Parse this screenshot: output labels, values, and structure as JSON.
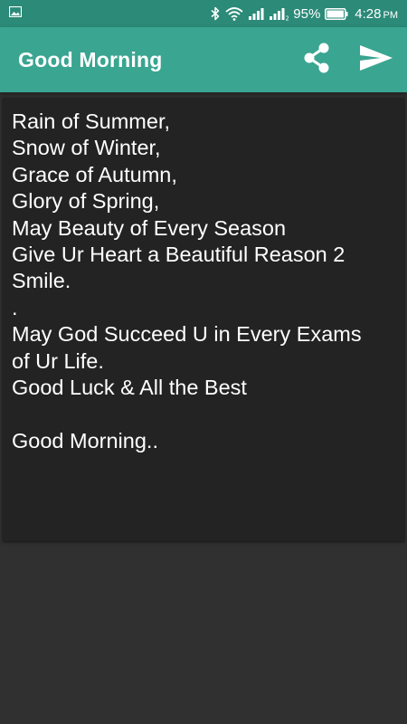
{
  "status_bar": {
    "battery_percent": "95%",
    "time": "4:28",
    "ampm": "PM",
    "icons": [
      "image-icon",
      "bluetooth-icon",
      "wifi-icon",
      "signal-icon",
      "signal-2-icon",
      "battery-icon"
    ]
  },
  "app_bar": {
    "title": "Good Morning",
    "share_icon": "share-icon",
    "send_icon": "send-icon",
    "background_color": "#3aa591"
  },
  "message": {
    "lines": [
      "Rain of Summer,",
      "Snow of Winter,",
      "Grace of Autumn,",
      "Glory of Spring,",
      "May Beauty of Every Season",
      "Give Ur Heart a Beautiful Reason 2",
      "Smile.",
      ".",
      "May God Succeed U in Every Exams",
      "of Ur Life.",
      "Good Luck & All the Best",
      "",
      "Good Morning.."
    ]
  }
}
